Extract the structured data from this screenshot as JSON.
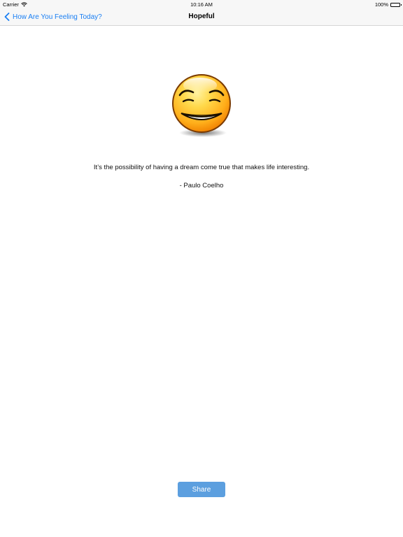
{
  "status_bar": {
    "carrier": "Carrier",
    "time": "10:16 AM",
    "battery": "100%"
  },
  "nav": {
    "back_label": "How Are You Feeling Today?",
    "title": "Hopeful"
  },
  "emoji": {
    "name": "hopeful-face",
    "colors": {
      "face_light": "#ffe066",
      "face_mid": "#ffb300",
      "face_dark": "#f08000",
      "outline": "#7a3a00"
    }
  },
  "quote": {
    "text": "It’s the possibility of having a dream come true that makes life interesting.",
    "author": "- Paulo Coelho"
  },
  "actions": {
    "share_label": "Share"
  },
  "colors": {
    "accent": "#1a7ff3",
    "button": "#5c9fdf"
  }
}
